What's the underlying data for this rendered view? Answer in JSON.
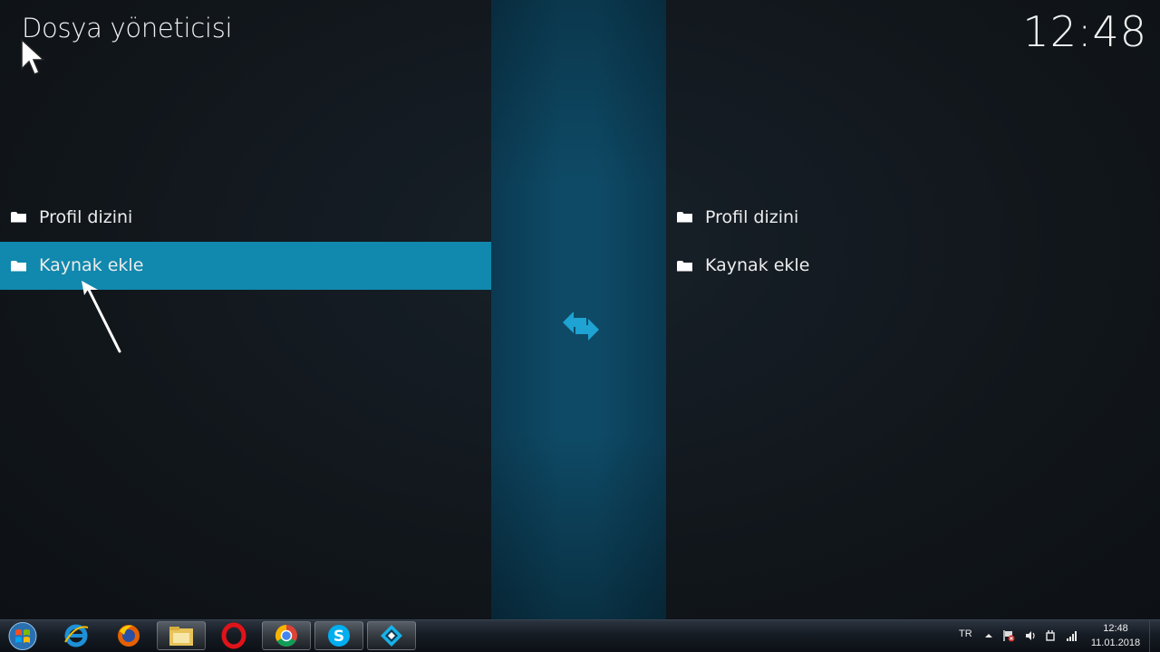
{
  "header": {
    "title": "Dosya yöneticisi",
    "clock": "12:48"
  },
  "left_pane": {
    "items": [
      {
        "label": "Profil dizini",
        "icon": "folder-icon"
      },
      {
        "label": "Kaynak ekle",
        "icon": "folder-icon",
        "focused": true
      }
    ]
  },
  "right_pane": {
    "items": [
      {
        "label": "Profil dizini",
        "icon": "folder-icon"
      },
      {
        "label": "Kaynak ekle",
        "icon": "folder-icon"
      }
    ]
  },
  "middle": {
    "icon": "swap-arrows-icon",
    "accent_color": "#1188ad"
  },
  "taskbar": {
    "apps": [
      {
        "name": "internet-explorer-icon"
      },
      {
        "name": "firefox-icon"
      },
      {
        "name": "file-explorer-icon"
      },
      {
        "name": "opera-icon"
      },
      {
        "name": "chrome-icon"
      },
      {
        "name": "skype-icon"
      },
      {
        "name": "kodi-icon"
      }
    ],
    "tray": {
      "language": "TR",
      "time": "12:48",
      "date": "11.01.2018"
    }
  },
  "colors": {
    "focus": "#1188ad",
    "background": "#12171c",
    "middle_band": "#0e4a66"
  }
}
